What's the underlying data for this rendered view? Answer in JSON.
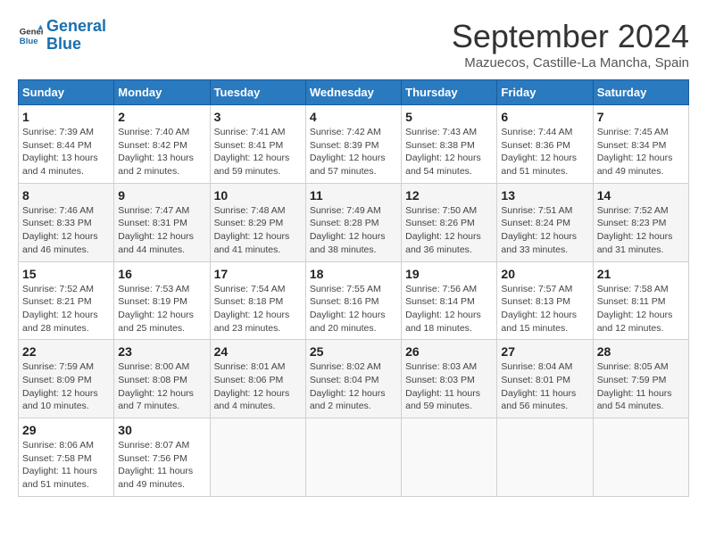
{
  "header": {
    "logo_line1": "General",
    "logo_line2": "Blue",
    "month": "September 2024",
    "location": "Mazuecos, Castille-La Mancha, Spain"
  },
  "weekdays": [
    "Sunday",
    "Monday",
    "Tuesday",
    "Wednesday",
    "Thursday",
    "Friday",
    "Saturday"
  ],
  "weeks": [
    [
      {
        "day": "1",
        "info": "Sunrise: 7:39 AM\nSunset: 8:44 PM\nDaylight: 13 hours and 4 minutes."
      },
      {
        "day": "2",
        "info": "Sunrise: 7:40 AM\nSunset: 8:42 PM\nDaylight: 13 hours and 2 minutes."
      },
      {
        "day": "3",
        "info": "Sunrise: 7:41 AM\nSunset: 8:41 PM\nDaylight: 12 hours and 59 minutes."
      },
      {
        "day": "4",
        "info": "Sunrise: 7:42 AM\nSunset: 8:39 PM\nDaylight: 12 hours and 57 minutes."
      },
      {
        "day": "5",
        "info": "Sunrise: 7:43 AM\nSunset: 8:38 PM\nDaylight: 12 hours and 54 minutes."
      },
      {
        "day": "6",
        "info": "Sunrise: 7:44 AM\nSunset: 8:36 PM\nDaylight: 12 hours and 51 minutes."
      },
      {
        "day": "7",
        "info": "Sunrise: 7:45 AM\nSunset: 8:34 PM\nDaylight: 12 hours and 49 minutes."
      }
    ],
    [
      {
        "day": "8",
        "info": "Sunrise: 7:46 AM\nSunset: 8:33 PM\nDaylight: 12 hours and 46 minutes."
      },
      {
        "day": "9",
        "info": "Sunrise: 7:47 AM\nSunset: 8:31 PM\nDaylight: 12 hours and 44 minutes."
      },
      {
        "day": "10",
        "info": "Sunrise: 7:48 AM\nSunset: 8:29 PM\nDaylight: 12 hours and 41 minutes."
      },
      {
        "day": "11",
        "info": "Sunrise: 7:49 AM\nSunset: 8:28 PM\nDaylight: 12 hours and 38 minutes."
      },
      {
        "day": "12",
        "info": "Sunrise: 7:50 AM\nSunset: 8:26 PM\nDaylight: 12 hours and 36 minutes."
      },
      {
        "day": "13",
        "info": "Sunrise: 7:51 AM\nSunset: 8:24 PM\nDaylight: 12 hours and 33 minutes."
      },
      {
        "day": "14",
        "info": "Sunrise: 7:52 AM\nSunset: 8:23 PM\nDaylight: 12 hours and 31 minutes."
      }
    ],
    [
      {
        "day": "15",
        "info": "Sunrise: 7:52 AM\nSunset: 8:21 PM\nDaylight: 12 hours and 28 minutes."
      },
      {
        "day": "16",
        "info": "Sunrise: 7:53 AM\nSunset: 8:19 PM\nDaylight: 12 hours and 25 minutes."
      },
      {
        "day": "17",
        "info": "Sunrise: 7:54 AM\nSunset: 8:18 PM\nDaylight: 12 hours and 23 minutes."
      },
      {
        "day": "18",
        "info": "Sunrise: 7:55 AM\nSunset: 8:16 PM\nDaylight: 12 hours and 20 minutes."
      },
      {
        "day": "19",
        "info": "Sunrise: 7:56 AM\nSunset: 8:14 PM\nDaylight: 12 hours and 18 minutes."
      },
      {
        "day": "20",
        "info": "Sunrise: 7:57 AM\nSunset: 8:13 PM\nDaylight: 12 hours and 15 minutes."
      },
      {
        "day": "21",
        "info": "Sunrise: 7:58 AM\nSunset: 8:11 PM\nDaylight: 12 hours and 12 minutes."
      }
    ],
    [
      {
        "day": "22",
        "info": "Sunrise: 7:59 AM\nSunset: 8:09 PM\nDaylight: 12 hours and 10 minutes."
      },
      {
        "day": "23",
        "info": "Sunrise: 8:00 AM\nSunset: 8:08 PM\nDaylight: 12 hours and 7 minutes."
      },
      {
        "day": "24",
        "info": "Sunrise: 8:01 AM\nSunset: 8:06 PM\nDaylight: 12 hours and 4 minutes."
      },
      {
        "day": "25",
        "info": "Sunrise: 8:02 AM\nSunset: 8:04 PM\nDaylight: 12 hours and 2 minutes."
      },
      {
        "day": "26",
        "info": "Sunrise: 8:03 AM\nSunset: 8:03 PM\nDaylight: 11 hours and 59 minutes."
      },
      {
        "day": "27",
        "info": "Sunrise: 8:04 AM\nSunset: 8:01 PM\nDaylight: 11 hours and 56 minutes."
      },
      {
        "day": "28",
        "info": "Sunrise: 8:05 AM\nSunset: 7:59 PM\nDaylight: 11 hours and 54 minutes."
      }
    ],
    [
      {
        "day": "29",
        "info": "Sunrise: 8:06 AM\nSunset: 7:58 PM\nDaylight: 11 hours and 51 minutes."
      },
      {
        "day": "30",
        "info": "Sunrise: 8:07 AM\nSunset: 7:56 PM\nDaylight: 11 hours and 49 minutes."
      },
      null,
      null,
      null,
      null,
      null
    ]
  ]
}
